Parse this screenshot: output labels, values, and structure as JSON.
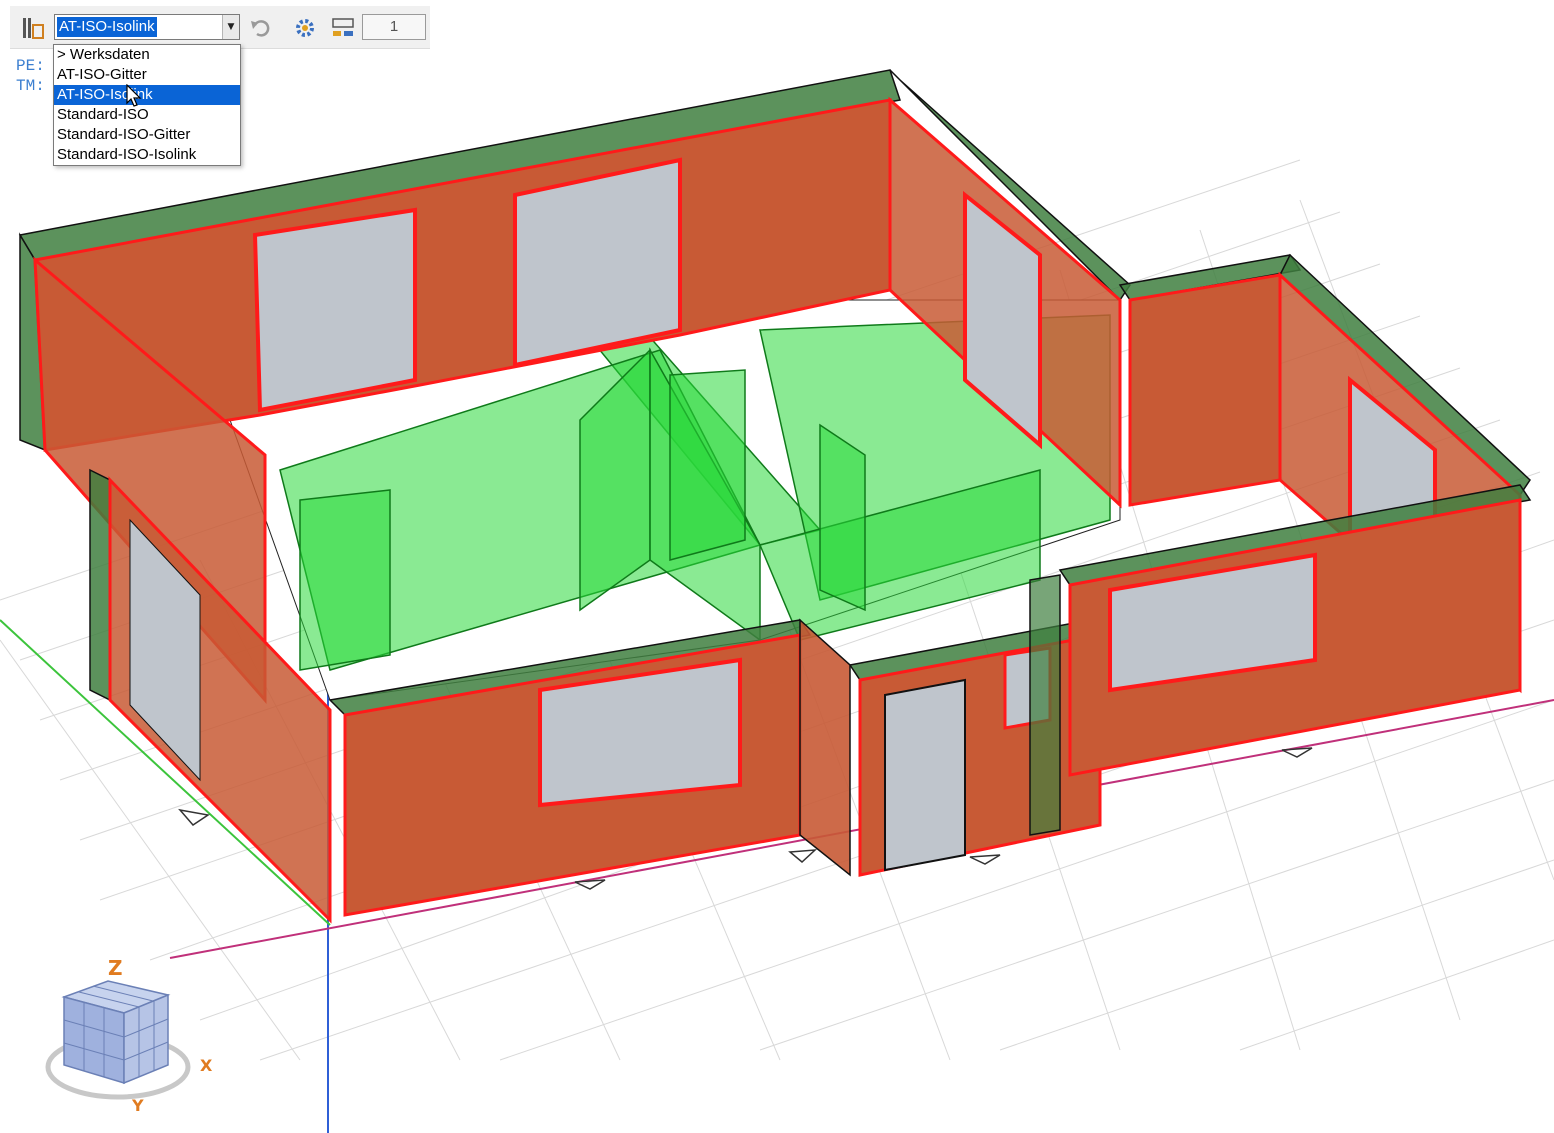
{
  "toolbar": {
    "profile_value": "AT-ISO-Isolink",
    "count_value": "1",
    "icons": [
      "structure-icon",
      "undo-icon",
      "settings-gear-icon",
      "layer-icon"
    ]
  },
  "dropdown": {
    "options": [
      "> Werksdaten",
      "AT-ISO-Gitter",
      "AT-ISO-Isolink",
      "Standard-ISO",
      "Standard-ISO-Gitter",
      "Standard-ISO-Isolink"
    ],
    "selected_index": 2
  },
  "side_labels": {
    "pe": "PE:",
    "tm": "TM:"
  },
  "navcube": {
    "axis_z": "Z",
    "axis_x": "X",
    "axis_y": "Y"
  },
  "colors": {
    "wall_fill": "#c85a35",
    "wall_outline": "#ff1a1a",
    "wall_cap": "#3f7f3f",
    "interior_green": "#2ad93a",
    "glass": "#bfc5cc",
    "grid": "#d8d8d8",
    "selection": "#0a64d6"
  }
}
